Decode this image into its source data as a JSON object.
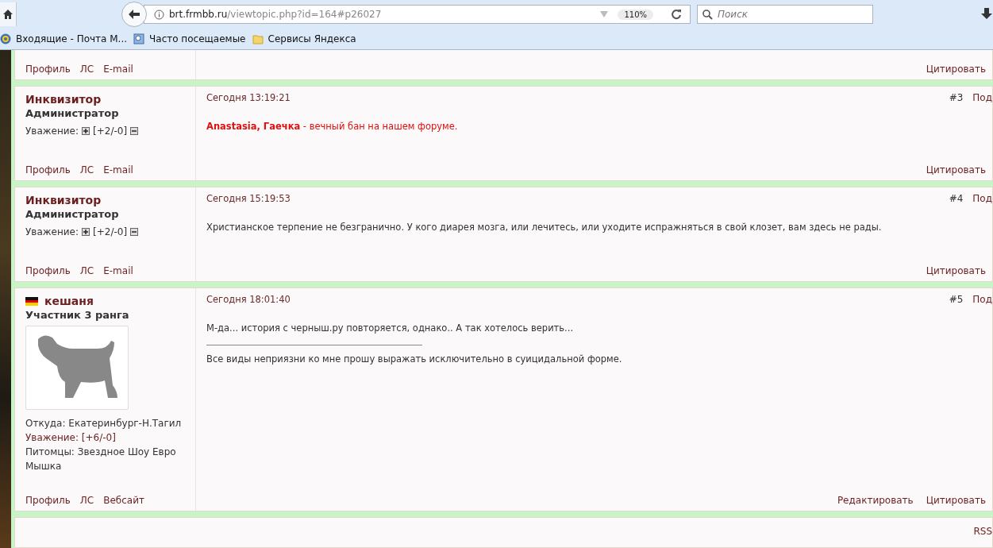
{
  "browser": {
    "url_host": "brt.frmbb.ru",
    "url_path": "/viewtopic.php?id=164#p26027",
    "zoom": "110%",
    "search_placeholder": "Поиск"
  },
  "bookmarks": [
    {
      "kind": "mail",
      "label": "Входящие - Почта М..."
    },
    {
      "kind": "history",
      "label": "Часто посещаемые"
    },
    {
      "kind": "folder",
      "label": "Сервисы Яндекса"
    }
  ],
  "partial_post": {
    "author_links": [
      "Профиль",
      "ЛС",
      "E-mail"
    ],
    "actions": [
      "Цитировать"
    ]
  },
  "posts": [
    {
      "author": "Инквизитор",
      "flag": false,
      "rank": "Администратор",
      "respect": {
        "label": "Уважение:",
        "value": "[+2/-0]"
      },
      "avatar": false,
      "date": "Сегодня 13:19:21",
      "number": "#3",
      "link": "Под",
      "body": [
        {
          "kind": "alert",
          "text": "**Anastasia, Гаечка** - вечный бан на нашем форуме."
        }
      ],
      "author_links": [
        "Профиль",
        "ЛС",
        "E-mail"
      ],
      "actions": [
        "Цитировать"
      ]
    },
    {
      "author": "Инквизитор",
      "flag": false,
      "rank": "Администратор",
      "respect": {
        "label": "Уважение:",
        "value": "[+2/-0]"
      },
      "avatar": false,
      "date": "Сегодня 15:19:53",
      "number": "#4",
      "link": "Под",
      "body": [
        {
          "kind": "plain",
          "text": "Христианское терпение не безгранично. У кого диарея мозга, или лечитесь, или уходите испражняться в свой клозет, вам здесь не рады."
        }
      ],
      "author_links": [
        "Профиль",
        "ЛС",
        "E-mail"
      ],
      "actions": [
        "Цитировать"
      ]
    },
    {
      "author": "кешаня",
      "flag": true,
      "rank": "Участник 3 ранга",
      "avatar": true,
      "fields": [
        {
          "label": "Откуда:",
          "value": "Екатеринбург-Н.Тагил",
          "link": false
        },
        {
          "label": "Уважение:",
          "value": "[+6/-0]",
          "link": true
        },
        {
          "label": "Питомцы:",
          "value": "Звездное Шоу Евро Мышка",
          "link": false
        }
      ],
      "date": "Сегодня 18:01:40",
      "number": "#5",
      "link": "Под",
      "body": [
        {
          "kind": "plain",
          "text": "М-да... история с черныш.ру повторяется, однако.. А так хотелось верить..."
        }
      ],
      "signature": [
        "Все виды неприязни ко мне прошу выражать исключительно в суицидальной форме."
      ],
      "author_links": [
        "Профиль",
        "ЛС",
        "Вебсайт"
      ],
      "actions": [
        "Редактировать",
        "Цитировать"
      ]
    }
  ],
  "footer": {
    "link": "RSS"
  }
}
